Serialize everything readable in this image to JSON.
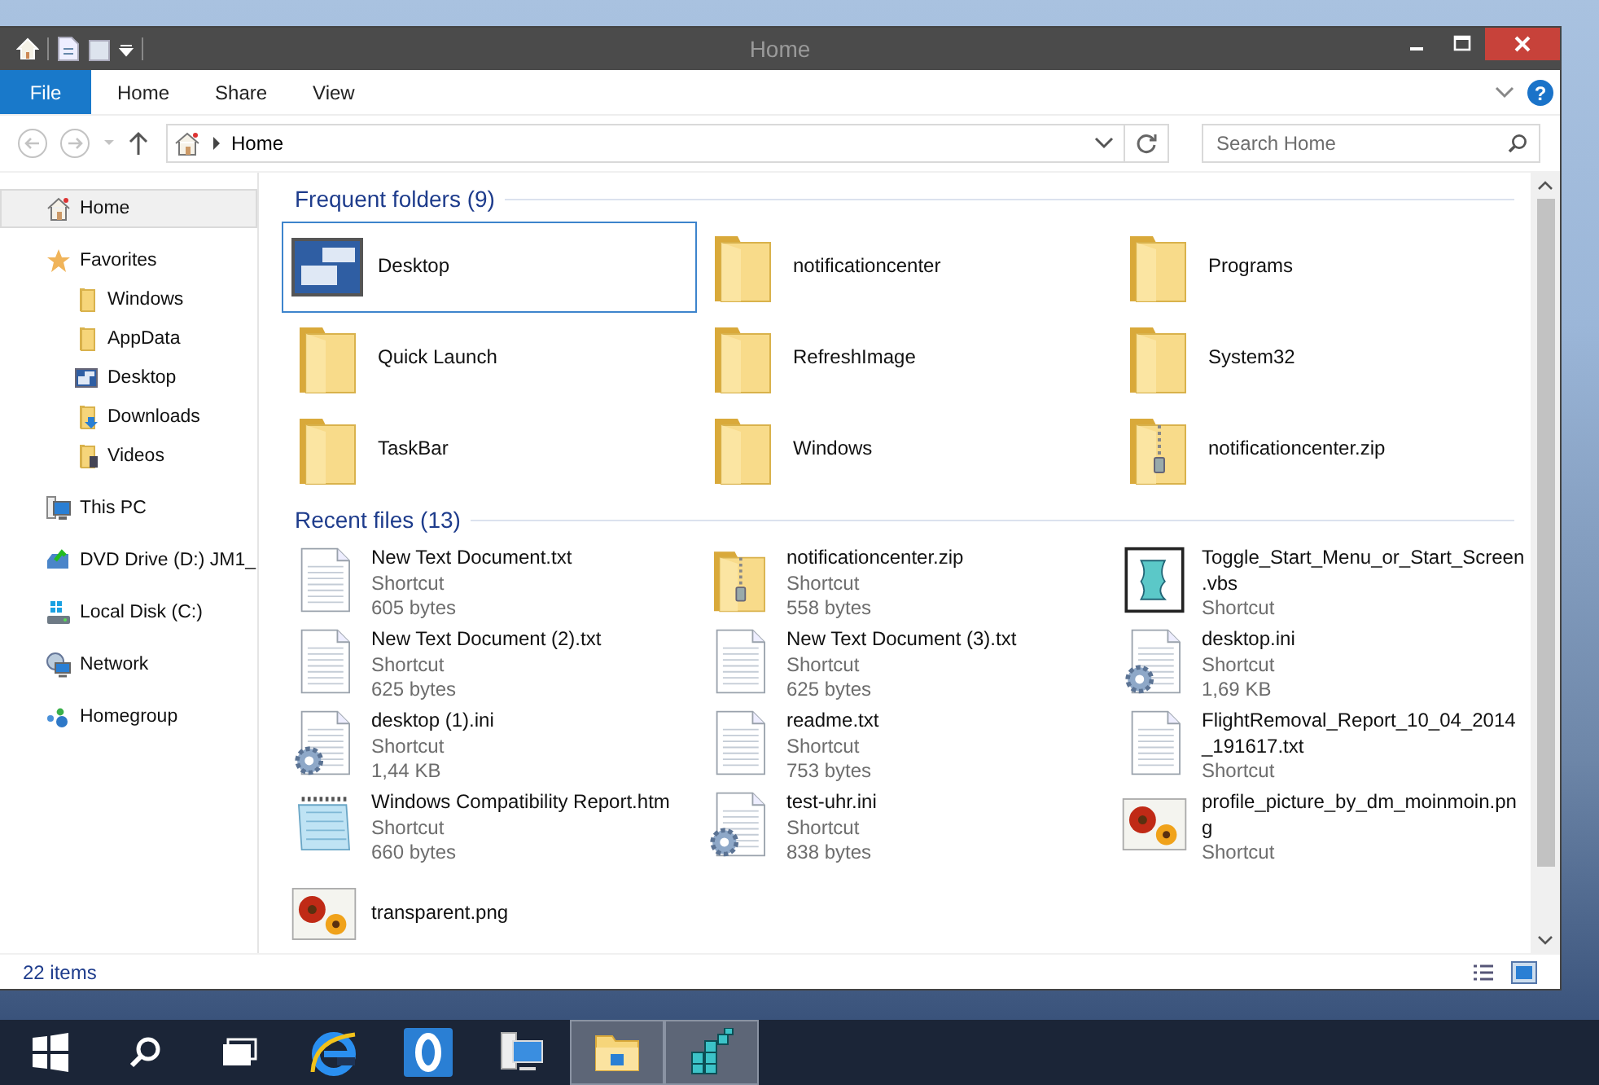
{
  "window": {
    "title": "Home"
  },
  "ribbon": {
    "tabs": [
      {
        "label": "File",
        "kind": "file"
      },
      {
        "label": "Home",
        "kind": "tab"
      },
      {
        "label": "Share",
        "kind": "tab"
      },
      {
        "label": "View",
        "kind": "tab"
      }
    ],
    "help": "?"
  },
  "address": {
    "path": "Home",
    "search": {
      "placeholder": "Search Home"
    }
  },
  "sidebar": {
    "items": [
      {
        "label": "Home",
        "kind": "home",
        "selected": true
      },
      {
        "label": "Favorites",
        "kind": "star",
        "selected": false,
        "children": [
          {
            "label": "Windows",
            "kind": "folder",
            "selected": false
          },
          {
            "label": "AppData",
            "kind": "folder",
            "selected": false
          },
          {
            "label": "Desktop",
            "kind": "desktop",
            "selected": false
          },
          {
            "label": "Downloads",
            "kind": "downloads",
            "selected": false
          },
          {
            "label": "Videos",
            "kind": "videos",
            "selected": false
          }
        ]
      },
      {
        "label": "This PC",
        "kind": "pc",
        "selected": false
      },
      {
        "label": "DVD Drive (D:) JM1_",
        "kind": "dvd",
        "selected": false
      },
      {
        "label": "Local Disk (C:)",
        "kind": "disk",
        "selected": false
      },
      {
        "label": "Network",
        "kind": "network",
        "selected": false
      },
      {
        "label": "Homegroup",
        "kind": "homegroup",
        "selected": false
      }
    ]
  },
  "sections": [
    {
      "title": "Frequent folders (9)",
      "items": [
        {
          "name": "Desktop",
          "kind": "desktop",
          "selected": true
        },
        {
          "name": "notificationcenter",
          "kind": "folder",
          "selected": false
        },
        {
          "name": "Programs",
          "kind": "folder",
          "selected": false
        },
        {
          "name": "Quick Launch",
          "kind": "folder",
          "selected": false
        },
        {
          "name": "RefreshImage",
          "kind": "folder",
          "selected": false
        },
        {
          "name": "System32",
          "kind": "folder",
          "selected": false
        },
        {
          "name": "TaskBar",
          "kind": "folder",
          "selected": false
        },
        {
          "name": "Windows",
          "kind": "folder",
          "selected": false
        },
        {
          "name": "notificationcenter.zip",
          "kind": "zip",
          "selected": false
        }
      ]
    },
    {
      "title": "Recent files (13)",
      "items": [
        {
          "name": "New Text Document.txt",
          "kind": "txt",
          "selected": false,
          "details": [
            "Shortcut",
            "605 bytes"
          ]
        },
        {
          "name": "notificationcenter.zip",
          "kind": "zip",
          "selected": false,
          "details": [
            "Shortcut",
            "558 bytes"
          ]
        },
        {
          "name": "Toggle_Start_Menu_or_Start_Screen.vbs",
          "kind": "script",
          "selected": false,
          "details": [
            "Shortcut"
          ]
        },
        {
          "name": "New Text Document (2).txt",
          "kind": "txt",
          "selected": false,
          "details": [
            "Shortcut",
            "625 bytes"
          ]
        },
        {
          "name": "New Text Document (3).txt",
          "kind": "txt",
          "selected": false,
          "details": [
            "Shortcut",
            "625 bytes"
          ]
        },
        {
          "name": "desktop.ini",
          "kind": "ini",
          "selected": false,
          "details": [
            "Shortcut",
            "1,69 KB"
          ]
        },
        {
          "name": "desktop (1).ini",
          "kind": "ini",
          "selected": false,
          "details": [
            "Shortcut",
            "1,44 KB"
          ]
        },
        {
          "name": "readme.txt",
          "kind": "txt",
          "selected": false,
          "details": [
            "Shortcut",
            "753 bytes"
          ]
        },
        {
          "name": "FlightRemoval_Report_10_04_2014_191617.txt",
          "kind": "txt",
          "selected": false,
          "details": [
            "Shortcut"
          ]
        },
        {
          "name": "Windows Compatibility Report.htm",
          "kind": "notes",
          "selected": false,
          "details": [
            "Shortcut",
            "660 bytes"
          ]
        },
        {
          "name": "test-uhr.ini",
          "kind": "ini",
          "selected": false,
          "details": [
            "Shortcut",
            "838 bytes"
          ]
        },
        {
          "name": "profile_picture_by_dm_moinmoin.png",
          "kind": "image",
          "selected": false,
          "details": [
            "Shortcut"
          ]
        },
        {
          "name": "transparent.png",
          "kind": "image",
          "selected": false
        }
      ]
    }
  ],
  "status_bar": {
    "count": "22 items"
  },
  "taskbar": {
    "items": [
      {
        "kind": "start",
        "open": false
      },
      {
        "kind": "search",
        "open": false
      },
      {
        "kind": "taskview",
        "open": false
      },
      {
        "kind": "browser",
        "open": false
      },
      {
        "kind": "ring",
        "open": false
      },
      {
        "kind": "network",
        "open": false
      },
      {
        "kind": "explorer",
        "open": true
      },
      {
        "kind": "cubes",
        "open": true
      }
    ]
  }
}
